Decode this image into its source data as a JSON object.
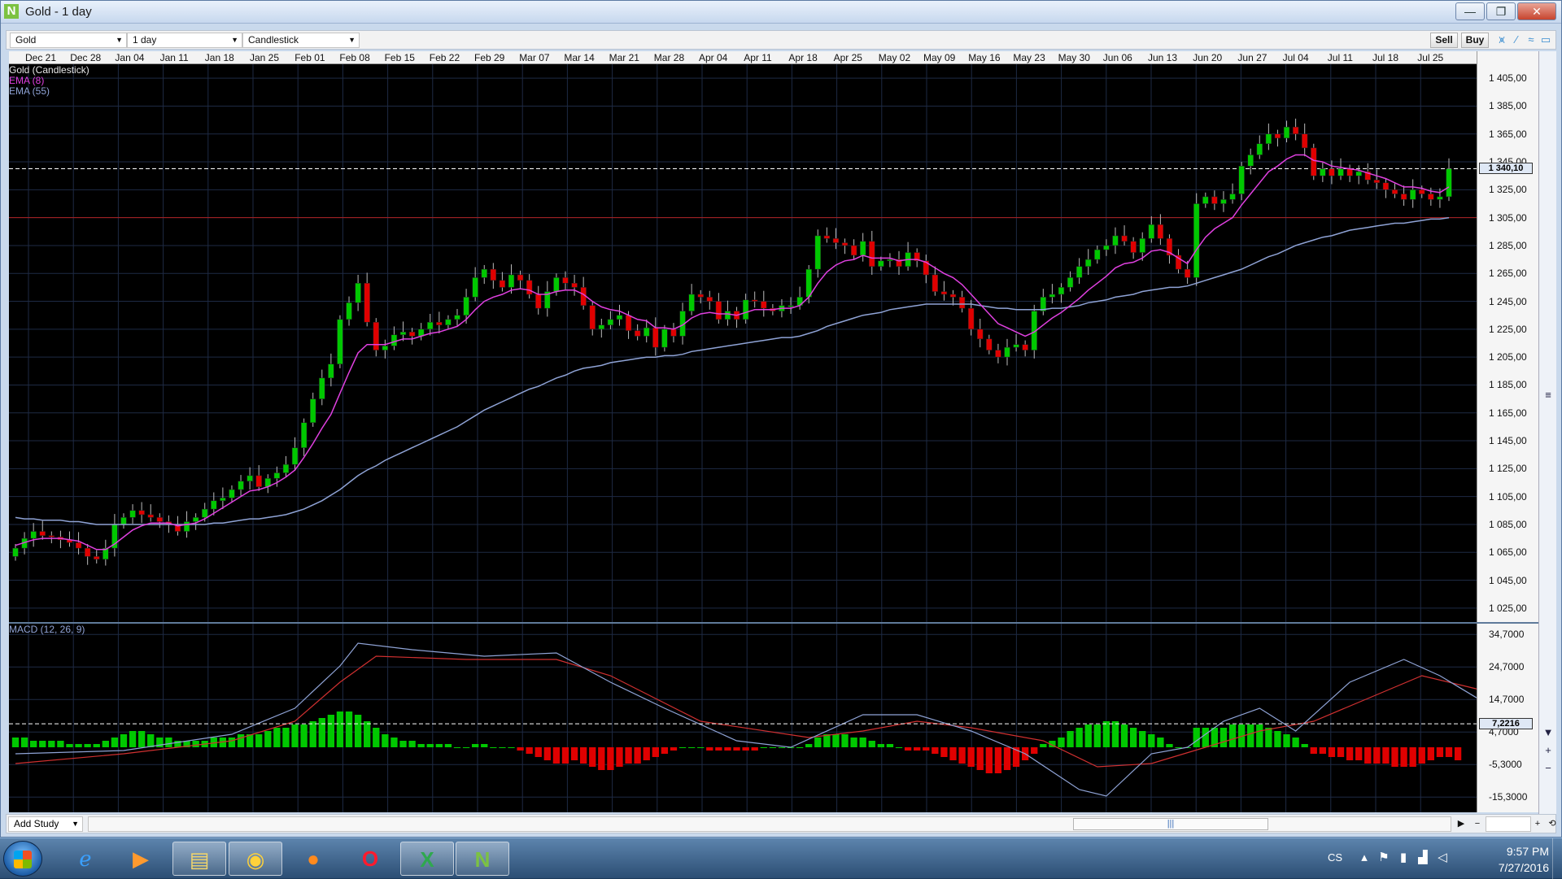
{
  "window": {
    "title": "Gold - 1 day",
    "logo": "N"
  },
  "window_controls": {
    "minimize": "—",
    "maximize": "❐",
    "close": "✕"
  },
  "toolbar": {
    "instrument": "Gold",
    "interval": "1 day",
    "chart_type": "Candlestick",
    "sell_label": "Sell",
    "buy_label": "Buy",
    "icons": [
      "line-study-icon",
      "draw-line-icon",
      "trend-icon",
      "window-icon"
    ]
  },
  "legend": {
    "series_label": "Gold (Candlestick)",
    "ema8_label": "EMA (8)",
    "ema55_label": "EMA (55)",
    "macd_label": "MACD (12, 26, 9)"
  },
  "colors": {
    "up": "#00c800",
    "down": "#e00000",
    "ema8": "#e040e0",
    "ema55": "#8fa3d6",
    "macd": "#8fa3d6",
    "signal": "#d03030",
    "resistance": "#b02020",
    "grid": "#1e2a44"
  },
  "date_axis": [
    "Dec 21",
    "Dec 28",
    "Jan 04",
    "Jan 11",
    "Jan 18",
    "Jan 25",
    "Feb 01",
    "Feb 08",
    "Feb 15",
    "Feb 22",
    "Feb 29",
    "Mar 07",
    "Mar 14",
    "Mar 21",
    "Mar 28",
    "Apr 04",
    "Apr 11",
    "Apr 18",
    "Apr 25",
    "May 02",
    "May 09",
    "May 16",
    "May 23",
    "May 30",
    "Jun 06",
    "Jun 13",
    "Jun 20",
    "Jun 27",
    "Jul 04",
    "Jul 11",
    "Jul 18",
    "Jul 25"
  ],
  "price_scale": {
    "labels": [
      "1 405,00",
      "1 385,00",
      "1 365,00",
      "1 345,00",
      "1 325,00",
      "1 305,00",
      "1 285,00",
      "1 265,00",
      "1 245,00",
      "1 225,00",
      "1 205,00",
      "1 185,00",
      "1 165,00",
      "1 145,00",
      "1 125,00",
      "1 105,00",
      "1 085,00",
      "1 065,00",
      "1 045,00",
      "1 025,00"
    ],
    "current_price": "1 340,10"
  },
  "macd_scale": {
    "labels": [
      "34,7000",
      "24,7000",
      "14,7000",
      "4,7000",
      "-5,3000",
      "-15,3000"
    ],
    "current_value": "7,2216"
  },
  "chart_data": {
    "type": "candlestick",
    "instrument": "Gold",
    "interval": "1 day",
    "x_axis_labels": [
      "Dec 21",
      "Dec 28",
      "Jan 04",
      "Jan 11",
      "Jan 18",
      "Jan 25",
      "Feb 01",
      "Feb 08",
      "Feb 15",
      "Feb 22",
      "Feb 29",
      "Mar 07",
      "Mar 14",
      "Mar 21",
      "Mar 28",
      "Apr 04",
      "Apr 11",
      "Apr 18",
      "Apr 25",
      "May 02",
      "May 09",
      "May 16",
      "May 23",
      "May 30",
      "Jun 06",
      "Jun 13",
      "Jun 20",
      "Jun 27",
      "Jul 04",
      "Jul 11",
      "Jul 18",
      "Jul 25"
    ],
    "ylim": [
      1015,
      1415
    ],
    "current_price": 1340.1,
    "resistance_level": 1305,
    "closes": [
      1068,
      1075,
      1080,
      1077,
      1076,
      1074,
      1072,
      1068,
      1062,
      1060,
      1068,
      1085,
      1090,
      1095,
      1092,
      1090,
      1087,
      1085,
      1080,
      1087,
      1090,
      1096,
      1102,
      1104,
      1110,
      1116,
      1120,
      1112,
      1118,
      1122,
      1128,
      1140,
      1158,
      1175,
      1190,
      1200,
      1232,
      1244,
      1258,
      1230,
      1210,
      1213,
      1221,
      1223,
      1220,
      1225,
      1230,
      1228,
      1232,
      1235,
      1248,
      1262,
      1268,
      1260,
      1255,
      1264,
      1260,
      1250,
      1240,
      1252,
      1262,
      1258,
      1255,
      1242,
      1225,
      1228,
      1232,
      1235,
      1224,
      1220,
      1226,
      1212,
      1225,
      1220,
      1238,
      1250,
      1248,
      1245,
      1232,
      1238,
      1232,
      1246,
      1245,
      1240,
      1238,
      1242,
      1242,
      1248,
      1268,
      1292,
      1290,
      1287,
      1285,
      1278,
      1288,
      1270,
      1274,
      1275,
      1270,
      1280,
      1274,
      1264,
      1252,
      1250,
      1248,
      1240,
      1225,
      1218,
      1210,
      1205,
      1212,
      1214,
      1210,
      1238,
      1248,
      1250,
      1255,
      1262,
      1270,
      1275,
      1282,
      1285,
      1292,
      1288,
      1280,
      1290,
      1300,
      1290,
      1278,
      1268,
      1262,
      1315,
      1320,
      1315,
      1318,
      1322,
      1342,
      1350,
      1358,
      1365,
      1362,
      1370,
      1365,
      1355,
      1335,
      1340,
      1335,
      1340,
      1335,
      1338,
      1332,
      1330,
      1325,
      1322,
      1318,
      1325,
      1322,
      1318,
      1320,
      1340
    ],
    "ema8": [
      1070,
      1072,
      1074,
      1075,
      1075,
      1075,
      1074,
      1073,
      1070,
      1067,
      1067,
      1071,
      1076,
      1081,
      1084,
      1086,
      1086,
      1086,
      1084,
      1085,
      1086,
      1089,
      1093,
      1097,
      1101,
      1105,
      1109,
      1110,
      1112,
      1115,
      1119,
      1124,
      1133,
      1143,
      1154,
      1164,
      1179,
      1194,
      1208,
      1214,
      1214,
      1214,
      1216,
      1218,
      1218,
      1220,
      1222,
      1223,
      1225,
      1227,
      1232,
      1239,
      1245,
      1248,
      1250,
      1253,
      1254,
      1253,
      1250,
      1250,
      1252,
      1253,
      1253,
      1250,
      1245,
      1241,
      1239,
      1238,
      1235,
      1232,
      1231,
      1226,
      1226,
      1225,
      1228,
      1233,
      1236,
      1237,
      1236,
      1236,
      1235,
      1237,
      1239,
      1239,
      1239,
      1240,
      1240,
      1242,
      1248,
      1258,
      1266,
      1271,
      1274,
      1275,
      1278,
      1276,
      1276,
      1276,
      1274,
      1275,
      1275,
      1273,
      1269,
      1265,
      1262,
      1257,
      1250,
      1243,
      1236,
      1229,
      1226,
      1223,
      1220,
      1223,
      1228,
      1233,
      1237,
      1242,
      1247,
      1253,
      1258,
      1263,
      1269,
      1272,
      1273,
      1276,
      1281,
      1282,
      1280,
      1276,
      1272,
      1282,
      1291,
      1297,
      1301,
      1305,
      1314,
      1322,
      1330,
      1338,
      1342,
      1347,
      1350,
      1350,
      1346,
      1345,
      1342,
      1341,
      1340,
      1339,
      1337,
      1335,
      1333,
      1330,
      1327,
      1327,
      1326,
      1324,
      1323,
      1327
    ],
    "ema55": [
      1090,
      1089,
      1089,
      1088,
      1088,
      1088,
      1087,
      1087,
      1086,
      1085,
      1085,
      1085,
      1085,
      1085,
      1085,
      1085,
      1085,
      1085,
      1085,
      1085,
      1085,
      1085,
      1086,
      1086,
      1087,
      1088,
      1089,
      1089,
      1090,
      1091,
      1092,
      1094,
      1096,
      1099,
      1102,
      1106,
      1110,
      1115,
      1120,
      1124,
      1127,
      1131,
      1134,
      1137,
      1140,
      1143,
      1146,
      1149,
      1152,
      1155,
      1159,
      1163,
      1167,
      1170,
      1173,
      1176,
      1179,
      1182,
      1184,
      1187,
      1190,
      1192,
      1195,
      1197,
      1198,
      1199,
      1201,
      1202,
      1203,
      1204,
      1205,
      1205,
      1206,
      1206,
      1207,
      1209,
      1210,
      1211,
      1212,
      1213,
      1214,
      1215,
      1216,
      1217,
      1218,
      1219,
      1219,
      1220,
      1222,
      1224,
      1227,
      1229,
      1231,
      1233,
      1235,
      1236,
      1237,
      1239,
      1240,
      1241,
      1242,
      1243,
      1243,
      1243,
      1243,
      1243,
      1243,
      1242,
      1241,
      1240,
      1240,
      1239,
      1239,
      1239,
      1239,
      1240,
      1240,
      1241,
      1242,
      1244,
      1245,
      1246,
      1248,
      1249,
      1250,
      1252,
      1253,
      1254,
      1255,
      1255,
      1256,
      1258,
      1260,
      1262,
      1264,
      1266,
      1268,
      1271,
      1274,
      1277,
      1279,
      1282,
      1285,
      1287,
      1289,
      1291,
      1292,
      1294,
      1296,
      1297,
      1298,
      1299,
      1300,
      1301,
      1301,
      1302,
      1303,
      1304,
      1304,
      1305
    ],
    "macd": {
      "ylim": [
        -20,
        38
      ],
      "macd_line_points": [
        [
          0,
          -2
        ],
        [
          12,
          -1
        ],
        [
          24,
          4
        ],
        [
          31,
          12
        ],
        [
          36,
          25
        ],
        [
          38,
          32
        ],
        [
          44,
          30
        ],
        [
          52,
          28
        ],
        [
          60,
          29
        ],
        [
          66,
          20
        ],
        [
          72,
          12
        ],
        [
          80,
          2
        ],
        [
          86,
          0
        ],
        [
          94,
          10
        ],
        [
          100,
          10
        ],
        [
          106,
          5
        ],
        [
          112,
          -2
        ],
        [
          118,
          -13
        ],
        [
          121,
          -15
        ],
        [
          126,
          -2
        ],
        [
          130,
          0
        ],
        [
          134,
          8
        ],
        [
          138,
          12
        ],
        [
          142,
          5
        ],
        [
          148,
          20
        ],
        [
          154,
          27
        ],
        [
          158,
          22
        ],
        [
          164,
          12
        ],
        [
          167,
          9
        ]
      ],
      "signal_line_points": [
        [
          0,
          -5
        ],
        [
          12,
          -2
        ],
        [
          24,
          2
        ],
        [
          31,
          8
        ],
        [
          36,
          20
        ],
        [
          40,
          28
        ],
        [
          50,
          27
        ],
        [
          60,
          27
        ],
        [
          66,
          22
        ],
        [
          76,
          8
        ],
        [
          88,
          3
        ],
        [
          94,
          5
        ],
        [
          100,
          8
        ],
        [
          106,
          6
        ],
        [
          114,
          2
        ],
        [
          120,
          -6
        ],
        [
          126,
          -5
        ],
        [
          132,
          0
        ],
        [
          138,
          5
        ],
        [
          144,
          8
        ],
        [
          150,
          15
        ],
        [
          156,
          22
        ],
        [
          162,
          18
        ],
        [
          167,
          12
        ]
      ],
      "histogram": [
        3,
        3,
        2,
        2,
        2,
        2,
        1,
        1,
        1,
        1,
        2,
        3,
        4,
        5,
        5,
        4,
        3,
        3,
        2,
        2,
        2,
        2,
        3,
        3,
        3,
        4,
        4,
        4,
        5,
        6,
        6,
        7,
        7,
        8,
        9,
        10,
        11,
        11,
        10,
        8,
        6,
        4,
        3,
        2,
        2,
        1,
        1,
        1,
        1,
        0,
        0,
        1,
        1,
        0,
        0,
        0,
        -1,
        -2,
        -3,
        -4,
        -5,
        -5,
        -4,
        -5,
        -6,
        -7,
        -7,
        -6,
        -5,
        -5,
        -4,
        -3,
        -2,
        -1,
        0,
        0,
        0,
        -1,
        -1,
        -1,
        -1,
        -1,
        -1,
        0,
        0,
        0,
        0,
        0,
        1,
        3,
        4,
        4,
        4,
        3,
        3,
        2,
        1,
        1,
        0,
        -1,
        -1,
        -1,
        -2,
        -3,
        -4,
        -5,
        -6,
        -7,
        -8,
        -8,
        -7,
        -6,
        -4,
        -2,
        1,
        2,
        3,
        5,
        6,
        7,
        7,
        8,
        8,
        7,
        6,
        5,
        4,
        3,
        1,
        0,
        0,
        6,
        6,
        6,
        6,
        7,
        7,
        7,
        7,
        6,
        5,
        4,
        3,
        1,
        -2,
        -2,
        -3,
        -3,
        -4,
        -4,
        -5,
        -5,
        -5,
        -6,
        -6,
        -6,
        -5,
        -4,
        -3,
        -3,
        -4
      ]
    }
  },
  "bottombar": {
    "add_study": "Add Study",
    "scroll_grip": "|||"
  },
  "taskbar": {
    "apps": [
      "explorer-icon",
      "ie-icon",
      "media-player-icon",
      "file-explorer-icon",
      "chrome-icon",
      "firefox-icon",
      "opera-icon",
      "excel-icon",
      "trading-app-icon"
    ],
    "language": "CS",
    "time": "9:57 PM",
    "date": "7/27/2016"
  }
}
